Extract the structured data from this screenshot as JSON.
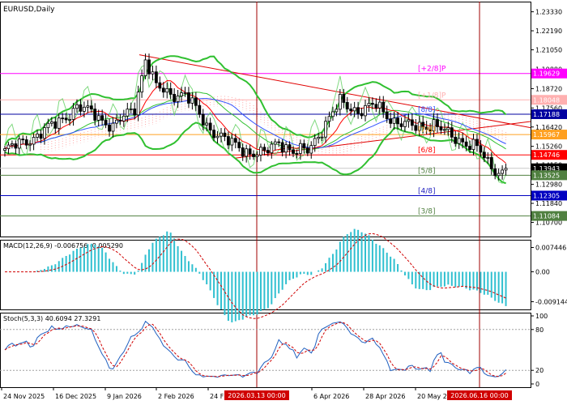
{
  "chart_data": {
    "type": "candlestick",
    "symbol_label": "EURUSD,Daily",
    "price_range": [
      1.0985,
      1.2394
    ],
    "price_ticks": [
      "1.23330",
      "1.22190",
      "1.21050",
      "1.19880",
      "1.18720",
      "1.17560",
      "1.16420",
      "1.15260",
      "1.14150",
      "1.12980",
      "1.11840",
      "1.10700"
    ],
    "highlight_levels": [
      {
        "label": "1.19629",
        "value": 1.19629,
        "line": "#ff00ff",
        "fill": "#ff00ff",
        "text_color": "#ffffff",
        "murrey": "[+2/8]P",
        "murrey_color": "#ff00ff"
      },
      {
        "label": "1.18048",
        "value": 1.18048,
        "line": "#ffb0b0",
        "fill": "#ffb0b0",
        "text_color": "#ffffff",
        "murrey": "[+1/8]P",
        "murrey_color": "#ffb0b0"
      },
      {
        "label": "1.17188",
        "value": 1.17188,
        "line": "#0000a0",
        "fill": "#0000a0",
        "text_color": "#ffffff",
        "murrey": "[8/8]",
        "murrey_color": "#3050ff"
      },
      {
        "label": "1.15967",
        "value": 1.15967,
        "line": "#ffa020",
        "fill": "#ffa020",
        "text_color": "#ffffff",
        "murrey": "[7/8]",
        "murrey_color": "#ffa020"
      },
      {
        "label": "1.14746",
        "value": 1.14746,
        "line": "#ff0000",
        "fill": "#ff0000",
        "text_color": "#ffffff",
        "murrey": "[6/8]",
        "murrey_color": "#ff0000"
      },
      {
        "label": "1.13943",
        "value": 1.13943,
        "line": "#c8c8c8",
        "fill": "#000000",
        "text_color": "#ffffff",
        "murrey": "",
        "murrey_color": "#000000"
      },
      {
        "label": "1.13525",
        "value": 1.13525,
        "line": "#508040",
        "fill": "#508040",
        "text_color": "#ffffff",
        "murrey": "[5/8]",
        "murrey_color": "#508040"
      },
      {
        "label": "1.12305",
        "value": 1.12305,
        "line": "#0000c0",
        "fill": "#0000c0",
        "text_color": "#ffffff",
        "murrey": "[4/8]",
        "murrey_color": "#2020c0"
      },
      {
        "label": "1.11084",
        "value": 1.11084,
        "line": "#508040",
        "fill": "#508040",
        "text_color": "#ffffff",
        "murrey": "[3/8]",
        "murrey_color": "#508040"
      }
    ],
    "date_labels": [
      "24 Nov 2025",
      "16 Dec 2025",
      "9 Jan 2026",
      "2 Feb 2026",
      "24 F",
      "6 Apr 2026",
      "28 Apr 2026",
      "20 May 2"
    ],
    "vertical_markers": [
      "2026.03.13 00:00",
      "2026.06.16 00:00"
    ],
    "trendlines": [
      {
        "from": [
          1.2075,
          "2026-01-12"
        ],
        "to": [
          1.1638,
          "2026-06-20"
        ]
      },
      {
        "from": [
          1.1455,
          "2025-11-24"
        ],
        "to": [
          1.1675,
          "2026-06-20"
        ]
      }
    ],
    "bar_count": 140,
    "waypoints": [
      [
        0,
        1.15
      ],
      [
        8,
        1.158
      ],
      [
        14,
        1.166
      ],
      [
        20,
        1.176
      ],
      [
        25,
        1.172
      ],
      [
        30,
        1.164
      ],
      [
        36,
        1.176
      ],
      [
        39,
        1.205
      ],
      [
        42,
        1.188
      ],
      [
        46,
        1.184
      ],
      [
        50,
        1.184
      ],
      [
        56,
        1.165
      ],
      [
        62,
        1.155
      ],
      [
        68,
        1.149
      ],
      [
        72,
        1.148
      ],
      [
        76,
        1.156
      ],
      [
        80,
        1.149
      ],
      [
        84,
        1.15
      ],
      [
        88,
        1.163
      ],
      [
        93,
        1.179
      ],
      [
        98,
        1.174
      ],
      [
        103,
        1.177
      ],
      [
        108,
        1.168
      ],
      [
        113,
        1.164
      ],
      [
        119,
        1.166
      ],
      [
        124,
        1.158
      ],
      [
        127,
        1.156
      ],
      [
        131,
        1.152
      ],
      [
        134,
        1.142
      ],
      [
        137,
        1.137
      ],
      [
        139,
        1.1394
      ]
    ],
    "macd": {
      "label": "MACD(12,26,9) -0.006756 -0.005290",
      "ticks": [
        "0.007446",
        "0.00",
        "-0.009144"
      ],
      "range": [
        -0.0115,
        0.0098
      ],
      "signal_value": -0.00529,
      "macd_value": -0.006756
    },
    "stoch": {
      "label": "Stoch(5,3,3) 40.6094 27.3291",
      "ticks": [
        "100",
        "80",
        "20",
        "0"
      ],
      "levels": [
        80,
        20
      ]
    },
    "colors": {
      "murrey_band": "#3050ff",
      "envelope": "#30c030",
      "kijun": "#ff0000",
      "tenkan": "#3050ff",
      "cloud": "#ff9090"
    }
  }
}
